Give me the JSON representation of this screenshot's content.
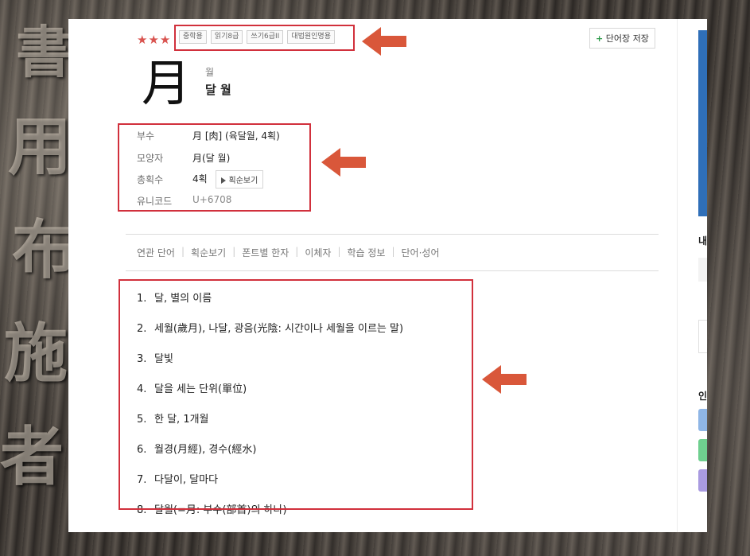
{
  "entry": {
    "stars": "★★★",
    "tags": [
      "중학용",
      "읽기8급",
      "쓰기6급II",
      "대법원인명용"
    ],
    "save_label": "단어장 저장",
    "save_icon": "plus-icon",
    "hanja": "月",
    "reading": "월",
    "meaning": "달 월"
  },
  "info": [
    {
      "label": "부수",
      "value": "月 [肉] (육달월, 4획)"
    },
    {
      "label": "모양자",
      "value": "月(달 월)"
    },
    {
      "label": "총획수",
      "value": "4획",
      "button": "획순보기"
    },
    {
      "label": "유니코드",
      "value": "U+6708"
    }
  ],
  "tabs": [
    "연관 단어",
    "획순보기",
    "폰트별 한자",
    "이체자",
    "학습 정보",
    "단어·성어"
  ],
  "definitions": [
    {
      "num": "1.",
      "text": "달, 별의 이름"
    },
    {
      "num": "2.",
      "text": "세월(歲月), 나달, 광음(光陰: 시간이나 세월을 이르는 말)"
    },
    {
      "num": "3.",
      "text": "달빛"
    },
    {
      "num": "4.",
      "text": "달을 세는 단위(單位)"
    },
    {
      "num": "5.",
      "text": "한 달, 1개월"
    },
    {
      "num": "6.",
      "text": "월경(月經), 경수(經水)"
    },
    {
      "num": "7.",
      "text": "다달이, 달마다"
    },
    {
      "num": "8.",
      "text": "달월(=月: 부수(部首)의 하나)"
    }
  ],
  "side": {
    "label1": "내",
    "label2": "인"
  },
  "colors": {
    "accent_red": "#d1303c",
    "arrow": "#d9573a",
    "star": "#d9534f",
    "blue": "#2f6fb8"
  }
}
